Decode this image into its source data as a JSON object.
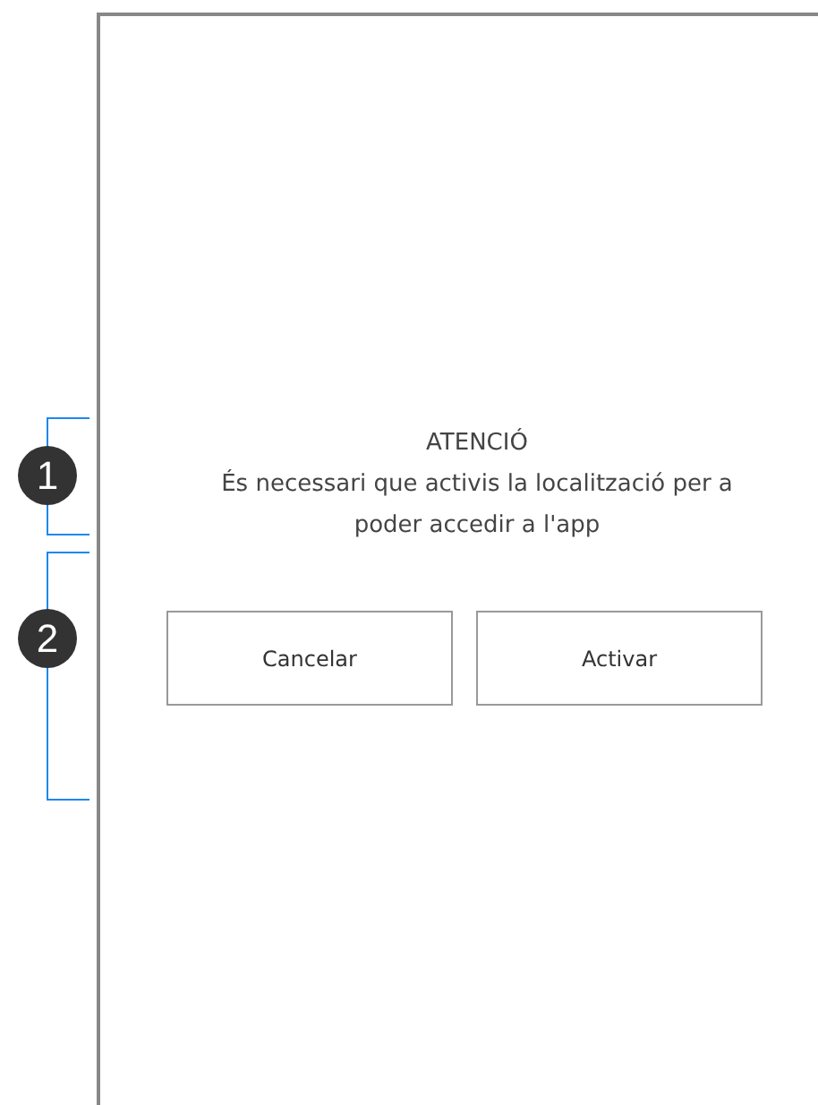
{
  "annotations": [
    {
      "number": "1"
    },
    {
      "number": "2"
    }
  ],
  "dialog": {
    "title": "ATENCIÓ",
    "message": "És necessari que activis la localització per a poder accedir a l'app"
  },
  "buttons": [
    {
      "label": "Cancelar"
    },
    {
      "label": "Activar"
    }
  ]
}
